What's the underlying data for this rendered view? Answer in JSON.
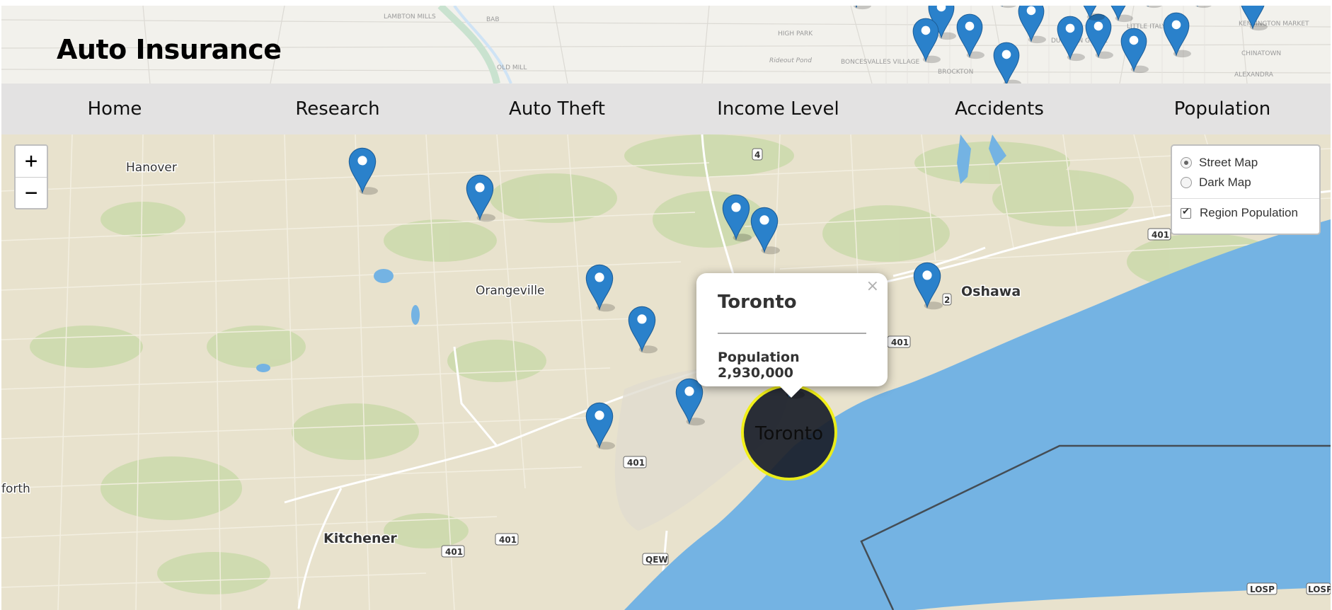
{
  "header": {
    "brand": "Auto Insurance",
    "map_labels": [
      "LAMBTON MILLS",
      "BAB",
      "HIGH PARK",
      "Rideout Pond",
      "OLD MILL",
      "BONCESVALLES VILLAGE",
      "BROCKTON",
      "DUFFERIN GROVE",
      "LITTLE ITALY",
      "KENSINGTON MARKET",
      "CHINATOWN",
      "ALEXANDRA"
    ]
  },
  "nav": {
    "items": [
      "Home",
      "Research",
      "Auto Theft",
      "Income Level",
      "Accidents",
      "Population"
    ]
  },
  "map": {
    "zoom_in": "+",
    "zoom_out": "−",
    "place_labels": {
      "hanover": "Hanover",
      "orangeville": "Orangeville",
      "oshawa": "Oshawa",
      "kitchener": "Kitchener",
      "seaforth": "forth"
    },
    "road_labels": [
      "4",
      "401",
      "401",
      "401",
      "401",
      "401",
      "401",
      "QEW",
      "2",
      "LOSP",
      "LOSP"
    ],
    "circle_label": "Toronto",
    "colors": {
      "land": "#e9e3cf",
      "water": "#74b3e3",
      "marker": "#2a81cb",
      "circle_stroke": "#f3f10a",
      "circle_fill": "#1a1f2a"
    }
  },
  "layers": {
    "base_options": [
      "Street Map",
      "Dark Map"
    ],
    "selected_base": "Street Map",
    "overlays": [
      "Region Population"
    ]
  },
  "popup": {
    "title": "Toronto",
    "body": "Population 2,930,000",
    "close": "×"
  }
}
